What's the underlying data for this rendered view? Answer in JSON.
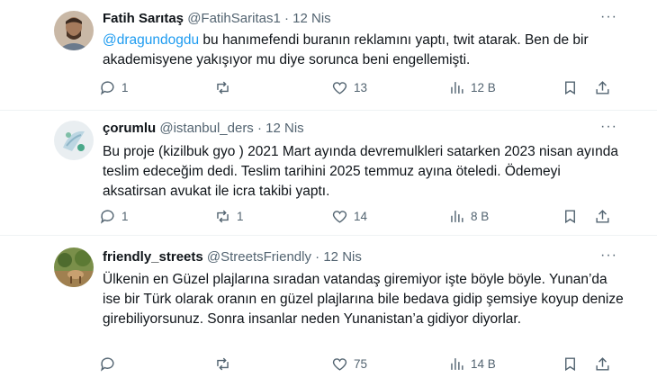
{
  "tweets": [
    {
      "name": "Fatih Sarıtaş",
      "handle": "@FatihSaritas1",
      "dot": "·",
      "date": "12 Nis",
      "mention": "@dragundogdu",
      "text": " bu hanımefendi buranın reklamını yaptı, twit atarak. Ben de bir akademisyene yakışıyor mu diye sorunca beni engellemişti.",
      "replies": "1",
      "retweets": "",
      "likes": "13",
      "views": "12 B"
    },
    {
      "name": "çorumlu",
      "handle": "@istanbul_ders",
      "dot": "·",
      "date": "12 Nis",
      "mention": "",
      "text": "Bu proje (kizilbuk gyo ) 2021 Mart ayında devremulkleri satarken 2023 nisan ayında teslim edeceğim dedi. Teslim tarihini 2025 temmuz ayına öteledi. Ödemeyi aksatirsan avukat ile icra takibi yaptı.",
      "replies": "1",
      "retweets": "1",
      "likes": "14",
      "views": "8 B"
    },
    {
      "name": "friendly_streets",
      "handle": "@StreetsFriendly",
      "dot": "·",
      "date": "12 Nis",
      "mention": "",
      "text": "Ülkenin en Güzel plajlarına sıradan vatandaş giremiyor işte böyle böyle. Yunan’da ise bir Türk olarak oranın en güzel plajlarına bile bedava gidip şemsiye koyup denize girebiliyorsunuz. Sonra insanlar neden Yunanistan’a gidiyor diyorlar.",
      "replies": "",
      "retweets": "",
      "likes": "75",
      "views": "14 B"
    }
  ],
  "more_label": "···",
  "icons": [
    "reply-icon",
    "retweet-icon",
    "like-icon",
    "views-icon",
    "bookmark-icon",
    "share-icon"
  ]
}
